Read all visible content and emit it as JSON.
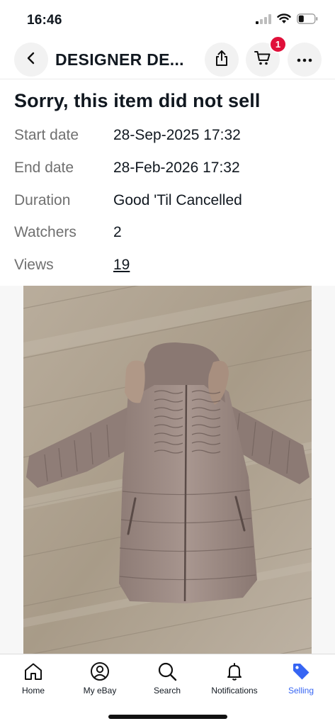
{
  "status_bar": {
    "time": "16:46",
    "signal_icon": "signal-icon",
    "wifi_icon": "wifi-icon",
    "battery_icon": "battery-icon"
  },
  "header": {
    "title": "DESIGNER DE...",
    "back_icon": "back-arrow-icon",
    "share_icon": "share-icon",
    "cart_icon": "cart-icon",
    "cart_count": "1",
    "more_icon": "more-dots-icon"
  },
  "listing": {
    "heading": "Sorry, this item did not sell",
    "rows": [
      {
        "label": "Start date",
        "value": "28-Sep-2025 17:32"
      },
      {
        "label": "End date",
        "value": "28-Feb-2026 17:32"
      },
      {
        "label": "Duration",
        "value": "Good 'Til Cancelled"
      },
      {
        "label": "Watchers",
        "value": "2"
      },
      {
        "label": "Views",
        "value": "19"
      }
    ]
  },
  "photo": {
    "subject": "coat-photo"
  },
  "bottom_nav": {
    "items": [
      {
        "label": "Home",
        "icon": "home-icon"
      },
      {
        "label": "My eBay",
        "icon": "account-icon"
      },
      {
        "label": "Search",
        "icon": "search-icon"
      },
      {
        "label": "Notifications",
        "icon": "bell-icon"
      },
      {
        "label": "Selling",
        "icon": "tag-icon",
        "active": true
      }
    ]
  },
  "colors": {
    "accent": "#3665f3",
    "badge": "#e0103a",
    "muted_text": "#707070"
  }
}
